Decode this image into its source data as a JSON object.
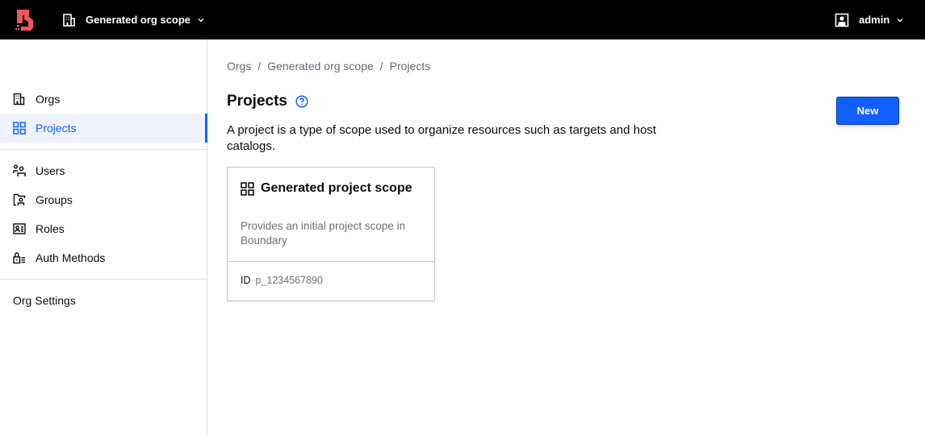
{
  "header": {
    "logo": "boundary-logo",
    "scope_switcher": {
      "icon": "building-icon",
      "label": "Generated org scope",
      "chevron": "chevron-down-icon"
    },
    "user_menu": {
      "icon": "user-square-icon",
      "label": "admin",
      "chevron": "chevron-down-icon"
    }
  },
  "sidebar": {
    "items": [
      {
        "label": "Orgs",
        "icon": "building-icon",
        "active": false
      },
      {
        "label": "Projects",
        "icon": "grid-icon",
        "active": true
      },
      {
        "label": "Users",
        "icon": "users-icon",
        "active": false
      },
      {
        "label": "Groups",
        "icon": "folder-users-icon",
        "active": false
      },
      {
        "label": "Roles",
        "icon": "id-card-icon",
        "active": false
      },
      {
        "label": "Auth Methods",
        "icon": "lock-list-icon",
        "active": false
      },
      {
        "label": "Org Settings",
        "icon": "",
        "active": false
      }
    ]
  },
  "breadcrumb": {
    "items": [
      "Orgs",
      "Generated org scope",
      "Projects"
    ],
    "separator": "/"
  },
  "page": {
    "title": "Projects",
    "help_icon": "help-circle-icon",
    "description": "A project is a type of scope used to organize resources such as targets and host catalogs.",
    "new_button": "New"
  },
  "cards": [
    {
      "icon": "grid-icon",
      "title": "Generated project scope",
      "description": "Provides an initial project scope in Boundary",
      "id_label": "ID",
      "id_value": "p_1234567890"
    }
  ],
  "colors": {
    "brand_red": "#ec585d",
    "accent_blue": "#1060ff",
    "topbar_bg": "#000000",
    "active_bg": "#eef3ff"
  }
}
